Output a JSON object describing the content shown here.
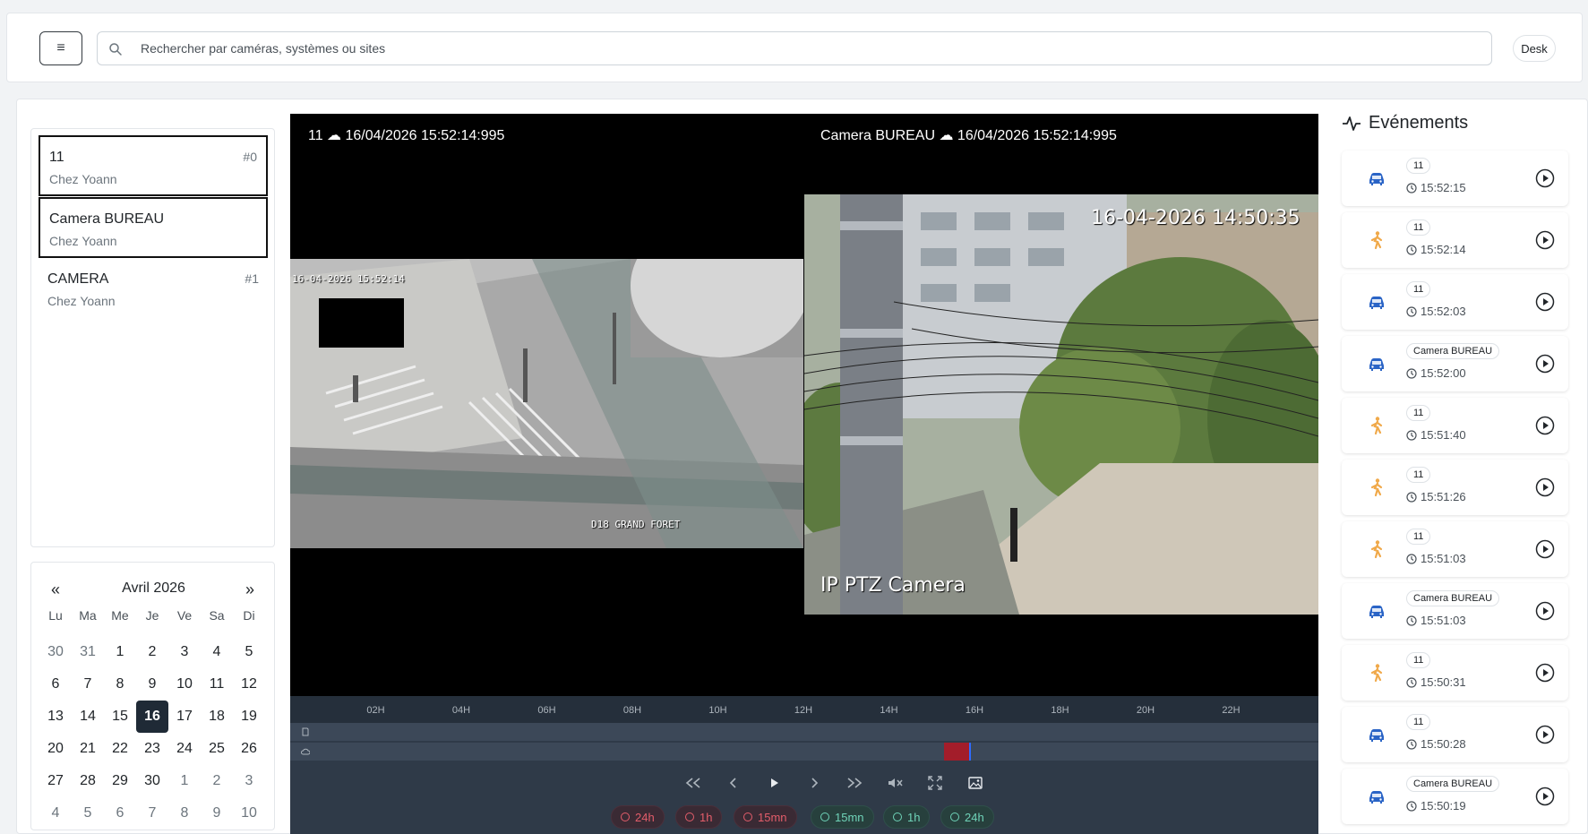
{
  "header": {
    "menu_icon": "hamburger-icon",
    "search_placeholder": "Rechercher par caméras, systèmes ou sites",
    "desk_label": "Desk"
  },
  "cameras": [
    {
      "name": "11",
      "site": "Chez Yoann",
      "id": "#0",
      "selected": true
    },
    {
      "name": "Camera BUREAU",
      "site": "Chez Yoann",
      "id": "",
      "selected": true
    },
    {
      "name": "CAMERA",
      "site": "Chez Yoann",
      "id": "#1",
      "selected": false
    }
  ],
  "calendar": {
    "prev": "«",
    "next": "»",
    "title": "Avril 2026",
    "weekdays": [
      "Lu",
      "Ma",
      "Me",
      "Je",
      "Ve",
      "Sa",
      "Di"
    ],
    "weeks": [
      [
        [
          "30",
          1
        ],
        [
          "31",
          1
        ],
        [
          "1",
          0
        ],
        [
          "2",
          0
        ],
        [
          "3",
          0
        ],
        [
          "4",
          0
        ],
        [
          "5",
          0
        ]
      ],
      [
        [
          "6",
          0
        ],
        [
          "7",
          0
        ],
        [
          "8",
          0
        ],
        [
          "9",
          0
        ],
        [
          "10",
          0
        ],
        [
          "11",
          0
        ],
        [
          "12",
          0
        ]
      ],
      [
        [
          "13",
          0
        ],
        [
          "14",
          0
        ],
        [
          "15",
          0
        ],
        [
          "16",
          2
        ],
        [
          "17",
          0
        ],
        [
          "18",
          0
        ],
        [
          "19",
          0
        ]
      ],
      [
        [
          "20",
          0
        ],
        [
          "21",
          0
        ],
        [
          "22",
          0
        ],
        [
          "23",
          0
        ],
        [
          "24",
          0
        ],
        [
          "25",
          0
        ],
        [
          "26",
          0
        ]
      ],
      [
        [
          "27",
          0
        ],
        [
          "28",
          0
        ],
        [
          "29",
          0
        ],
        [
          "30",
          0
        ],
        [
          "1",
          1
        ],
        [
          "2",
          1
        ],
        [
          "3",
          1
        ]
      ],
      [
        [
          "4",
          1
        ],
        [
          "5",
          1
        ],
        [
          "6",
          1
        ],
        [
          "7",
          1
        ],
        [
          "8",
          1
        ],
        [
          "9",
          1
        ],
        [
          "10",
          1
        ]
      ]
    ]
  },
  "video": {
    "left_overlay": "11 ☁ 16/04/2026 15:52:14:995",
    "right_overlay": "Camera BUREAU ☁ 16/04/2026 15:52:14:995",
    "feed1_timestamp": "16-04-2026 15:52:14",
    "feed1_caption": "D18   GRAND FORET",
    "feed2_timestamp": "16-04-2026 14:50:35",
    "feed2_caption": "IP PTZ Camera"
  },
  "timeline": {
    "hours": [
      "02H",
      "04H",
      "06H",
      "08H",
      "10H",
      "12H",
      "14H",
      "16H",
      "18H",
      "20H",
      "22H"
    ],
    "jumps_back": [
      "24h",
      "1h",
      "15mn"
    ],
    "jumps_forward": [
      "15mn",
      "1h",
      "24h"
    ],
    "recording_color": "#a31d2a",
    "cursor_color": "#2f6bff"
  },
  "events": {
    "title": "Evénements",
    "items": [
      {
        "type": "car",
        "camera": "11",
        "time": "15:52:15"
      },
      {
        "type": "person",
        "camera": "11",
        "time": "15:52:14"
      },
      {
        "type": "car",
        "camera": "11",
        "time": "15:52:03"
      },
      {
        "type": "car",
        "camera": "Camera BUREAU",
        "time": "15:52:00"
      },
      {
        "type": "person",
        "camera": "11",
        "time": "15:51:40"
      },
      {
        "type": "person",
        "camera": "11",
        "time": "15:51:26"
      },
      {
        "type": "person",
        "camera": "11",
        "time": "15:51:03"
      },
      {
        "type": "car",
        "camera": "Camera BUREAU",
        "time": "15:51:03"
      },
      {
        "type": "person",
        "camera": "11",
        "time": "15:50:31"
      },
      {
        "type": "car",
        "camera": "11",
        "time": "15:50:28"
      },
      {
        "type": "car",
        "camera": "Camera BUREAU",
        "time": "15:50:19"
      }
    ],
    "car_color": "#2a64c6",
    "person_color": "#f0a94a"
  }
}
